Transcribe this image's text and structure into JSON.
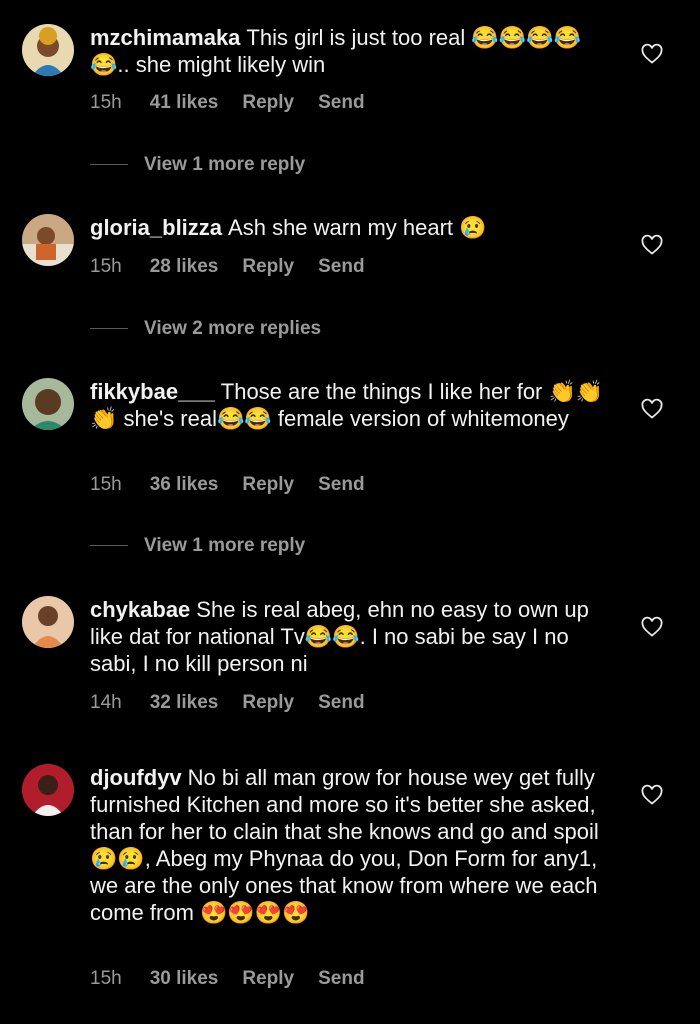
{
  "comments": [
    {
      "username": "mzchimamaka",
      "text": "This girl is just too real 😂😂😂😂😂.. she might likely win",
      "time": "15h",
      "likes": "41 likes",
      "reply": "Reply",
      "send": "Send",
      "view_replies": "View 1 more reply",
      "avatar_color": "#c9a227"
    },
    {
      "username": "gloria_blizza",
      "text": "Ash she warn my heart 😢",
      "time": "15h",
      "likes": "28 likes",
      "reply": "Reply",
      "send": "Send",
      "view_replies": "View 2 more replies",
      "avatar_color": "#b46e3c"
    },
    {
      "username": "fikkybae___",
      "text": "Those are the things I like her for 👏👏👏 she's real😂😂 female version of whitemoney",
      "time": "15h",
      "likes": "36 likes",
      "reply": "Reply",
      "send": "Send",
      "view_replies": "View 1 more reply",
      "avatar_color": "#7a5a3a"
    },
    {
      "username": "chykabae",
      "text": "She is real abeg, ehn no easy to own up like dat for national Tv😂😂. I no sabi be say I no sabi, I no kill person ni",
      "time": "14h",
      "likes": "32 likes",
      "reply": "Reply",
      "send": "Send",
      "avatar_color": "#d98a5a"
    },
    {
      "username": "djoufdyv",
      "text": "No bi all man grow for house wey get fully furnished Kitchen and more so it's better she asked, than for her to clain that she knows and go and spoil😢😢, Abeg my Phynaa do you, Don Form for any1, we are the only ones that know from where we each come from 😍😍😍😍",
      "time": "15h",
      "likes": "30 likes",
      "reply": "Reply",
      "send": "Send",
      "avatar_color": "#b21d2b"
    }
  ],
  "icons": {
    "like": "heart-outline-icon"
  },
  "colors": {
    "background": "#000000",
    "text": "#f2f2f2",
    "secondary": "#9a9a9a"
  }
}
